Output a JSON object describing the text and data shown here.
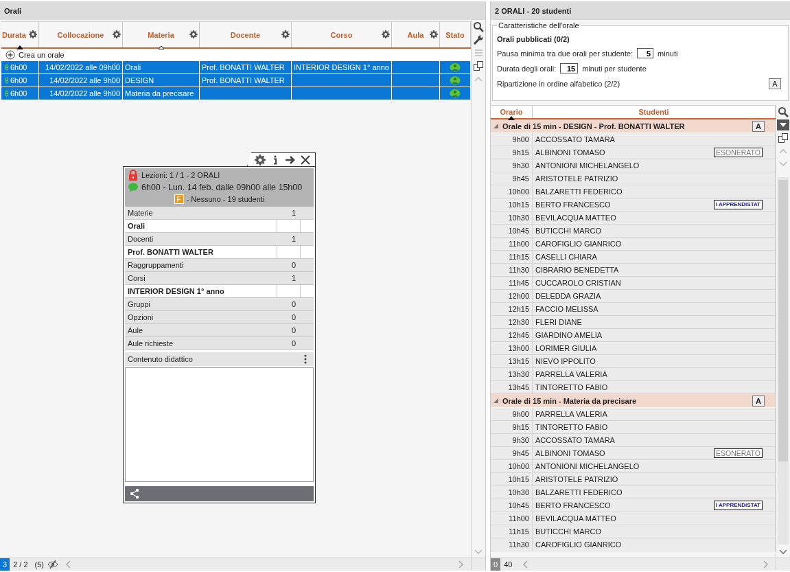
{
  "left_panel": {
    "title": "Orali",
    "columns": [
      {
        "label": "Durata",
        "gear": true,
        "sort_primary": true,
        "sort_secondary": false
      },
      {
        "label": "Collocazione",
        "gear": true,
        "sort_primary": false,
        "sort_secondary": false
      },
      {
        "label": "Materia",
        "gear": true,
        "sort_primary": false,
        "sort_secondary": true
      },
      {
        "label": "Docente",
        "gear": true,
        "sort_primary": false,
        "sort_secondary": false
      },
      {
        "label": "Corso",
        "gear": true,
        "sort_primary": false,
        "sort_secondary": false
      },
      {
        "label": "Aula",
        "gear": true,
        "sort_primary": false,
        "sort_secondary": false
      },
      {
        "label": "Stato",
        "gear": false,
        "sort_primary": false,
        "sort_secondary": false
      }
    ],
    "create_label": "Crea un orale",
    "rows": [
      {
        "durata": "6h00",
        "collocazione": "14/02/2022  alle 09h00",
        "materia": "Orali",
        "docente": "Prof. BONATTI WALTER",
        "corso": "INTERIOR DESIGN  1° anno",
        "aula": "",
        "selected": true
      },
      {
        "durata": "6h00",
        "collocazione": "14/02/2022 alle 9h00",
        "materia": "DESIGN",
        "docente": "Prof. BONATTI WALTER",
        "corso": "",
        "aula": "",
        "selected": true
      },
      {
        "durata": "6h00",
        "collocazione": "14/02/2022 alle 9h00",
        "materia": "Materia da precisare",
        "docente": "",
        "corso": "",
        "aula": "",
        "selected": true
      }
    ],
    "footer": {
      "selected_count": "3",
      "pages": "2 / 2",
      "hidden": "(5)"
    }
  },
  "popup": {
    "lessons": "Lezioni: 1 / 1 - 2 ORALI",
    "time": "6h00 - Lun. 14 feb. dalle 09h00 alle 15h00",
    "badge": "F",
    "group": "- Nessuno - 19 studenti",
    "rows": [
      {
        "kind": "header",
        "label": "Materie",
        "count": "1"
      },
      {
        "kind": "item",
        "label": "Orali"
      },
      {
        "kind": "header",
        "label": "Docenti",
        "count": "1"
      },
      {
        "kind": "item",
        "label": "Prof. BONATTI WALTER"
      },
      {
        "kind": "header",
        "label": "Raggruppamenti",
        "count": "0"
      },
      {
        "kind": "header",
        "label": "Corsi",
        "count": "1"
      },
      {
        "kind": "item",
        "label": "INTERIOR DESIGN  1° anno"
      },
      {
        "kind": "header",
        "label": "Gruppi",
        "count": "0"
      },
      {
        "kind": "header",
        "label": "Opzioni",
        "count": "0"
      },
      {
        "kind": "header",
        "label": "Aule",
        "count": "0"
      },
      {
        "kind": "header",
        "label": "Aule richieste",
        "count": "0"
      }
    ],
    "content_label": "Contenuto didattico"
  },
  "right_panel": {
    "title": "2 ORALI - 20 studenti",
    "settings": {
      "legend": "Caratteristiche dell'orale",
      "published": "Orali pubblicati (0/2)",
      "pause_label": "Pausa minima tra due orali per studente:",
      "pause_value": "5",
      "pause_unit": "minuti",
      "duration_label": "Durata degli orali:",
      "duration_value": "15",
      "duration_unit": "minuti per studente",
      "distribution": "Ripartizione in ordine alfabetico (2/2)",
      "sort_button": "A"
    },
    "columns": [
      "Orario",
      "Studenti"
    ],
    "groups": [
      {
        "title": "Orale di 15 min - DESIGN - Prof. BONATTI WALTER",
        "expanded": true,
        "sort_button": "A",
        "rows": [
          {
            "time": "9h00",
            "name": "ACCOSSATO TAMARA"
          },
          {
            "time": "9h15",
            "name": "ALBINONI TOMASO",
            "tag": {
              "kind": "exempt",
              "text": "ESONERATO"
            }
          },
          {
            "time": "9h30",
            "name": "ANTONIONI MICHELANGELO"
          },
          {
            "time": "9h45",
            "name": "ARISTOTELE PATRIZIO"
          },
          {
            "time": "10h00",
            "name": "BALZARETTI FEDERICO"
          },
          {
            "time": "10h15",
            "name": "BERTO FRANCESCO",
            "tag": {
              "kind": "apprentice",
              "text": "I APPRENDISTAT"
            }
          },
          {
            "time": "10h30",
            "name": "BEVILACQUA MATTEO"
          },
          {
            "time": "10h45",
            "name": "BUTICCHI MARCO"
          },
          {
            "time": "11h00",
            "name": "CAROFIGLIO GIANRICO"
          },
          {
            "time": "11h15",
            "name": "CASELLI CHIARA"
          },
          {
            "time": "11h30",
            "name": "CIBRARIO BENEDETTA"
          },
          {
            "time": "11h45",
            "name": "CUCCAROLO CRISTIAN"
          },
          {
            "time": "12h00",
            "name": "DELEDDA GRAZIA"
          },
          {
            "time": "12h15",
            "name": "FACCIO MELISSA"
          },
          {
            "time": "12h30",
            "name": "FLERI DIANE"
          },
          {
            "time": "12h45",
            "name": "GIARDINO AMELIA"
          },
          {
            "time": "13h00",
            "name": "LORIMER GIULIA"
          },
          {
            "time": "13h15",
            "name": "NIEVO IPPOLITO"
          },
          {
            "time": "13h30",
            "name": "PARRELLA VALERIA"
          },
          {
            "time": "13h45",
            "name": "TINTORETTO FABIO"
          }
        ]
      },
      {
        "title": "Orale di 15 min - Materia da precisare",
        "expanded": true,
        "sort_button": "A",
        "rows": [
          {
            "time": "9h00",
            "name": "PARRELLA VALERIA"
          },
          {
            "time": "9h15",
            "name": "TINTORETTO FABIO"
          },
          {
            "time": "9h30",
            "name": "ACCOSSATO TAMARA"
          },
          {
            "time": "9h45",
            "name": "ALBINONI TOMASO",
            "tag": {
              "kind": "exempt",
              "text": "ESONERATO"
            }
          },
          {
            "time": "10h00",
            "name": "ANTONIONI MICHELANGELO"
          },
          {
            "time": "10h15",
            "name": "ARISTOTELE PATRIZIO"
          },
          {
            "time": "10h30",
            "name": "BALZARETTI FEDERICO"
          },
          {
            "time": "10h45",
            "name": "BERTO FRANCESCO",
            "tag": {
              "kind": "apprentice",
              "text": "I APPRENDISTAT"
            }
          },
          {
            "time": "11h00",
            "name": "BEVILACQUA MATTEO"
          },
          {
            "time": "11h15",
            "name": "BUTICCHI MARCO"
          },
          {
            "time": "11h30",
            "name": "CAROFIGLIO GIANRICO"
          }
        ]
      }
    ],
    "footer": {
      "zero": "0",
      "count": "40"
    }
  }
}
